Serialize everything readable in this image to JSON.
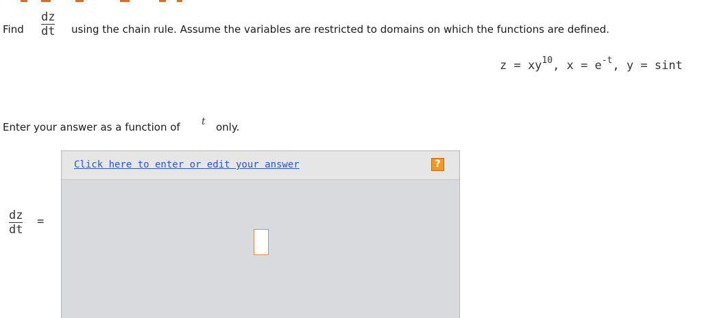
{
  "colors": {
    "accent": "#e46a1e",
    "link": "#2a55c6",
    "help_button": "#f29a1f",
    "answer_area": "#d8dadd"
  },
  "question": {
    "find_label": "Find",
    "fraction_numerator": "dz",
    "fraction_denominator": "dt",
    "rest": "using the chain rule. Assume the variables are restricted to domains on which the functions are defined."
  },
  "equation": {
    "z_part": "z = xy",
    "z_exponent": "10",
    "sep1": ", x = e",
    "x_exponent": "-t",
    "sep2": ", y = sint"
  },
  "instruction": {
    "text": "Enter your answer as a function of",
    "variable": "t",
    "suffix": "only."
  },
  "answer": {
    "edit_link": "Click here to enter or edit your answer",
    "help_symbol": "?",
    "help_icon": "help-icon",
    "lhs_numerator": "dz",
    "lhs_denominator": "dt",
    "equals": "="
  }
}
